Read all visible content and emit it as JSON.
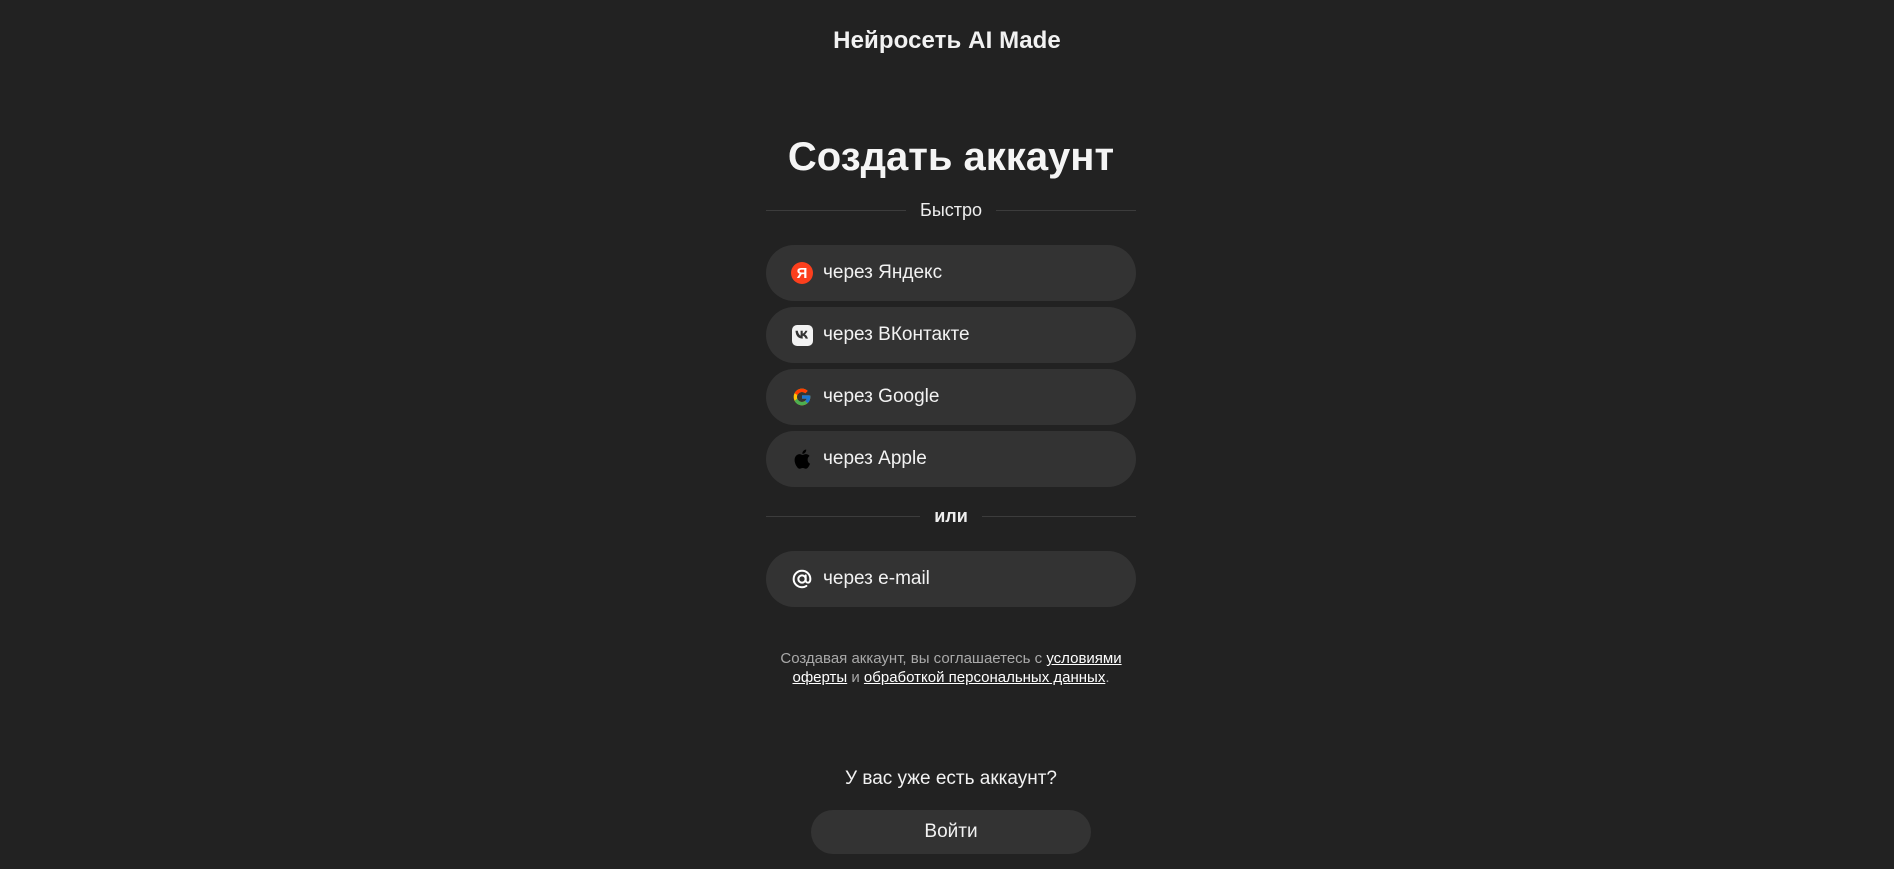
{
  "header": {
    "brand": "Нейросеть AI Made"
  },
  "signup": {
    "title": "Создать аккаунт",
    "fast_label": "Быстро",
    "or_label": "или",
    "providers": [
      {
        "icon": "yandex-icon",
        "label": "через Яндекс",
        "icon_text": "Я",
        "color": "#fc3f1d"
      },
      {
        "icon": "vk-icon",
        "label": "через ВКонтакте"
      },
      {
        "icon": "google-icon",
        "label": "через Google"
      },
      {
        "icon": "apple-icon",
        "label": "через Apple"
      }
    ],
    "email": {
      "icon": "at-icon",
      "label": "через e-mail"
    }
  },
  "terms": {
    "prefix": "Создавая аккаунт, вы соглашаетесь с",
    "offer_link": "условиями оферты",
    "conjunction": "и",
    "privacy_link": "обработкой персональных данных",
    "suffix": "."
  },
  "login": {
    "prompt": "У вас уже есть аккаунт?",
    "button": "Войти"
  },
  "colors": {
    "background": "#222222",
    "button": "#333333",
    "yandex": "#fc3f1d"
  }
}
